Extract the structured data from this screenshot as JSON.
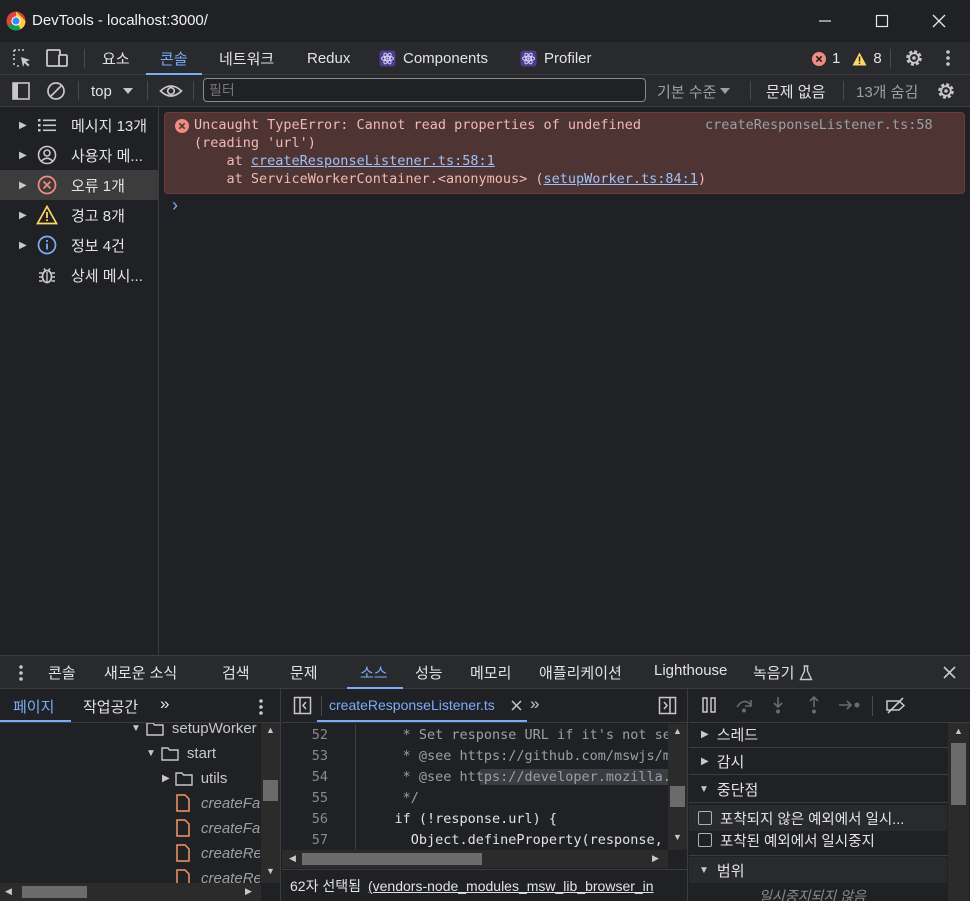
{
  "window": {
    "title": "DevTools - localhost:3000/"
  },
  "main_tabs": [
    {
      "label": "요소"
    },
    {
      "label": "콘솔",
      "active": true
    },
    {
      "label": "네트워크"
    },
    {
      "label": "Redux"
    },
    {
      "label": "Components"
    },
    {
      "label": "Profiler"
    }
  ],
  "status_counts": {
    "errors": "1",
    "warnings": "8"
  },
  "console_toolbar": {
    "context": "top",
    "filter_placeholder": "필터",
    "level": "기본 수준",
    "issues": "문제 없음",
    "hidden": "13개 숨김"
  },
  "sidebar": {
    "items": [
      {
        "label": "메시지 13개",
        "icon": "list-icon"
      },
      {
        "label": "사용자 메...",
        "icon": "user-icon"
      },
      {
        "label": "오류 1개",
        "icon": "error-icon",
        "selected": true
      },
      {
        "label": "경고 8개",
        "icon": "warning-icon"
      },
      {
        "label": "정보 4건",
        "icon": "info-icon"
      },
      {
        "label": "상세 메시...",
        "icon": "bug-icon"
      }
    ]
  },
  "console": {
    "error": {
      "message": "Uncaught TypeError: Cannot read properties of undefined",
      "message_cont": "(reading 'url')",
      "source": "createResponseListener.ts:58",
      "stack1_prefix": "    at ",
      "stack1_link": "createResponseListener.ts:58:1",
      "stack2_prefix": "    at ServiceWorkerContainer.<anonymous> (",
      "stack2_link": "setupWorker.ts:84:1",
      "stack2_suffix": ")"
    },
    "prompt": "›"
  },
  "drawer_tabs": [
    {
      "label": "콘솔"
    },
    {
      "label": "새로운 소식"
    },
    {
      "label": "검색"
    },
    {
      "label": "문제"
    },
    {
      "label": "소스",
      "active": true
    },
    {
      "label": "성능"
    },
    {
      "label": "메모리"
    },
    {
      "label": "애플리케이션"
    },
    {
      "label": "Lighthouse"
    },
    {
      "label": "녹음기"
    }
  ],
  "navigator": {
    "tabs": [
      {
        "label": "페이지",
        "active": true
      },
      {
        "label": "작업공간"
      }
    ],
    "tree": [
      {
        "label": "setupWorker",
        "type": "folder"
      },
      {
        "label": "start",
        "type": "folder"
      },
      {
        "label": "utils",
        "type": "folder"
      },
      {
        "label": "createFa",
        "type": "file"
      },
      {
        "label": "createFa",
        "type": "file"
      },
      {
        "label": "createRe",
        "type": "file"
      },
      {
        "label": "createRe",
        "type": "file"
      }
    ]
  },
  "editor": {
    "file_tab": "createResponseListener.ts",
    "lines": [
      {
        "num": "52",
        "text": "     * Set response URL if it's not set"
      },
      {
        "num": "53",
        "text": "     * @see https://github.com/mswjs/msw"
      },
      {
        "num": "54",
        "text": "     * @see https://developer.mozilla.o"
      },
      {
        "num": "55",
        "text": "     */"
      },
      {
        "num": "56",
        "text": "    if (!response.url) {"
      },
      {
        "num": "57",
        "text": "      Object.defineProperty(response, '"
      }
    ],
    "status": "62자 선택됨",
    "status_link": "(vendors-node_modules_msw_lib_browser_in"
  },
  "debugger": {
    "sections": [
      {
        "label": "스레드",
        "expanded": false
      },
      {
        "label": "감시",
        "expanded": false
      },
      {
        "label": "중단점",
        "expanded": true
      },
      {
        "label": "범위",
        "expanded": true
      }
    ],
    "checkboxes": [
      {
        "label": "포착되지 않은 예외에서 일시..."
      },
      {
        "label": "포착된 예외에서 일시중지"
      }
    ],
    "scope_note": "일시중지되지 않음"
  },
  "colors": {
    "accent": "#7cacf8",
    "error_bg": "#4e3534",
    "error_text": "#f2b8b5",
    "error_icon": "#f28b82",
    "warning_icon": "#fdd663"
  }
}
